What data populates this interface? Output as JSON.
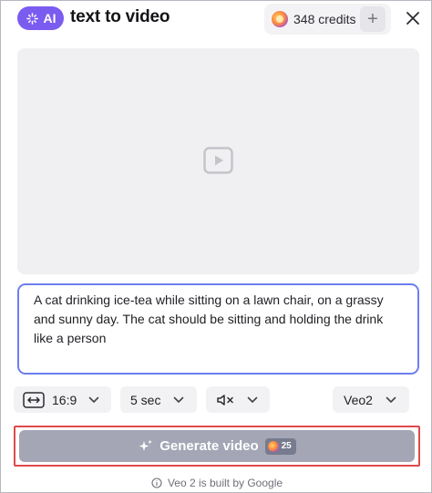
{
  "header": {
    "badge_label": "AI",
    "title": "text to video",
    "credits_text": "348 credits",
    "add_credits_label": "+"
  },
  "prompt": {
    "value": "A cat drinking ice-tea while sitting on a lawn chair, on a grassy and sunny day. The cat should be sitting and holding the drink like a person"
  },
  "controls": {
    "aspect_ratio": "16:9",
    "duration": "5 sec",
    "sound": "muted",
    "model": "Veo2"
  },
  "generate": {
    "label": "Generate video",
    "cost": "25"
  },
  "footer": {
    "note": "Veo 2 is built by Google"
  },
  "colors": {
    "accent": "#7b5cf0",
    "prompt_border": "#6d7ef0",
    "button_disabled": "#a4a6b5",
    "highlight": "#e0494b"
  }
}
